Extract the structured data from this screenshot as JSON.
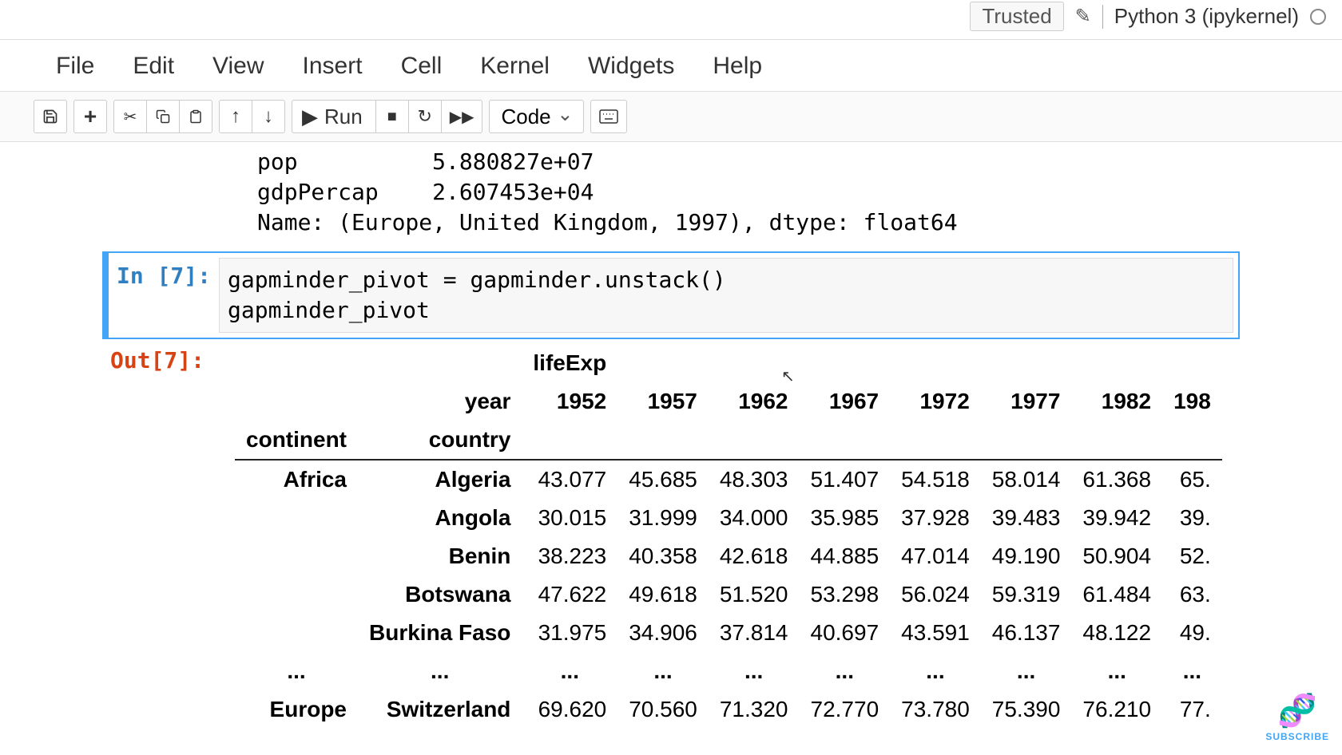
{
  "header": {
    "trusted": "Trusted",
    "kernel": "Python 3 (ipykernel)"
  },
  "menu": [
    "File",
    "Edit",
    "View",
    "Insert",
    "Cell",
    "Kernel",
    "Widgets",
    "Help"
  ],
  "toolbar": {
    "run_label": "Run",
    "cell_type": "Code"
  },
  "prev_output": {
    "line1": "pop          5.880827e+07",
    "line2": "gdpPercap    2.607453e+04",
    "line3": "Name: (Europe, United Kingdom, 1997), dtype: float64"
  },
  "cell": {
    "in_prompt": "In [7]:",
    "code": "gapminder_pivot = gapminder.unstack()\ngapminder_pivot",
    "out_prompt": "Out[7]:"
  },
  "pivot": {
    "top_metric": "lifeExp",
    "year_label": "year",
    "years": [
      "1952",
      "1957",
      "1962",
      "1967",
      "1972",
      "1977",
      "1982",
      "198"
    ],
    "continent_label": "continent",
    "country_label": "country",
    "rows": [
      {
        "continent": "Africa",
        "country": "Algeria",
        "vals": [
          "43.077",
          "45.685",
          "48.303",
          "51.407",
          "54.518",
          "58.014",
          "61.368",
          "65."
        ]
      },
      {
        "continent": "",
        "country": "Angola",
        "vals": [
          "30.015",
          "31.999",
          "34.000",
          "35.985",
          "37.928",
          "39.483",
          "39.942",
          "39."
        ]
      },
      {
        "continent": "",
        "country": "Benin",
        "vals": [
          "38.223",
          "40.358",
          "42.618",
          "44.885",
          "47.014",
          "49.190",
          "50.904",
          "52."
        ]
      },
      {
        "continent": "",
        "country": "Botswana",
        "vals": [
          "47.622",
          "49.618",
          "51.520",
          "53.298",
          "56.024",
          "59.319",
          "61.484",
          "63."
        ]
      },
      {
        "continent": "",
        "country": "Burkina Faso",
        "vals": [
          "31.975",
          "34.906",
          "37.814",
          "40.697",
          "43.591",
          "46.137",
          "48.122",
          "49."
        ]
      }
    ],
    "ellipsis": "...",
    "last_row": {
      "continent": "Europe",
      "country": "Switzerland",
      "vals": [
        "69.620",
        "70.560",
        "71.320",
        "72.770",
        "73.780",
        "75.390",
        "76.210",
        "77."
      ]
    }
  },
  "subscribe": "SUBSCRIBE"
}
